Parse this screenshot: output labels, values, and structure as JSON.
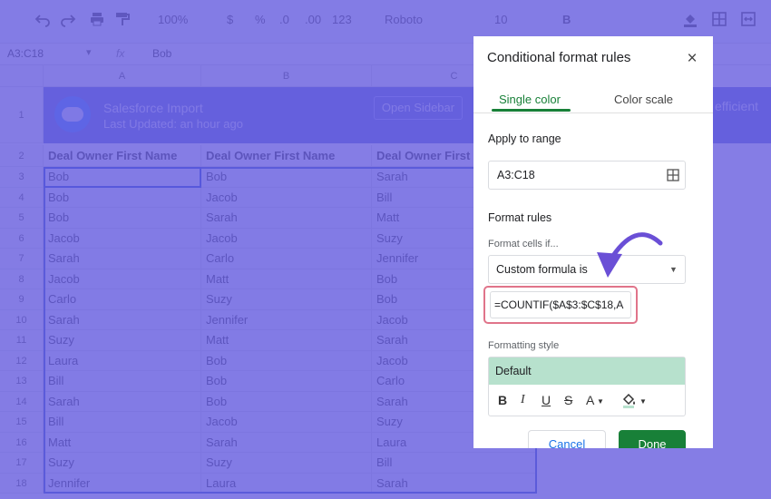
{
  "toolbar": {
    "zoom": "100%",
    "currency": "$",
    "percent": "%",
    "dec_decrease": ".0",
    "dec_increase": ".00",
    "format_more": "123",
    "font": "Roboto",
    "font_size": "10",
    "bold": "B"
  },
  "formula_bar": {
    "name_box": "A3:C18",
    "fx": "fx",
    "value": "Bob"
  },
  "columns": [
    "A",
    "B",
    "C"
  ],
  "banner": {
    "title": "Salesforce Import",
    "subtitle": "Last Updated: an hour ago",
    "button": "Open Sidebar",
    "right_text": "efficient"
  },
  "sheet": {
    "headers": [
      "Deal Owner First Name",
      "Deal Owner First Name",
      "Deal Owner First"
    ],
    "row_numbers": [
      "1",
      "2",
      "3",
      "4",
      "5",
      "6",
      "7",
      "8",
      "9",
      "10",
      "11",
      "12",
      "13",
      "14",
      "15",
      "16",
      "17",
      "18"
    ],
    "rows": [
      [
        "Bob",
        "Bob",
        "Sarah"
      ],
      [
        "Bob",
        "Jacob",
        "Bill"
      ],
      [
        "Bob",
        "Sarah",
        "Matt"
      ],
      [
        "Jacob",
        "Jacob",
        "Suzy"
      ],
      [
        "Sarah",
        "Carlo",
        "Jennifer"
      ],
      [
        "Jacob",
        "Matt",
        "Bob"
      ],
      [
        "Carlo",
        "Suzy",
        "Bob"
      ],
      [
        "Sarah",
        "Jennifer",
        "Jacob"
      ],
      [
        "Suzy",
        "Matt",
        "Sarah"
      ],
      [
        "Laura",
        "Bob",
        "Jacob"
      ],
      [
        "Bill",
        "Bob",
        "Carlo"
      ],
      [
        "Sarah",
        "Bob",
        "Sarah"
      ],
      [
        "Bill",
        "Jacob",
        "Suzy"
      ],
      [
        "Matt",
        "Sarah",
        "Laura"
      ],
      [
        "Suzy",
        "Suzy",
        "Bill"
      ],
      [
        "Jennifer",
        "Laura",
        "Sarah"
      ]
    ]
  },
  "panel": {
    "title": "Conditional format rules",
    "close": "×",
    "tabs": [
      {
        "label": "Single color",
        "active": true
      },
      {
        "label": "Color scale",
        "active": false
      }
    ],
    "apply_to_range_label": "Apply to range",
    "range_value": "A3:C18",
    "format_rules_label": "Format rules",
    "format_cells_if_label": "Format cells if...",
    "condition_value": "Custom formula is",
    "formula_value": "=COUNTIF($A$3:$C$18,A",
    "formatting_style_label": "Formatting style",
    "style_preset": "Default",
    "style_tools": {
      "bold": "B",
      "italic": "I",
      "underline": "U",
      "strike": "S",
      "text_color": "A"
    },
    "cancel_label": "Cancel",
    "done_label": "Done"
  },
  "colors": {
    "overlay": "#675cde",
    "accent_green": "#188038",
    "highlight_border": "#e0748a",
    "style_preview": "#b7e1cd",
    "arrow": "#6a4fd6"
  }
}
